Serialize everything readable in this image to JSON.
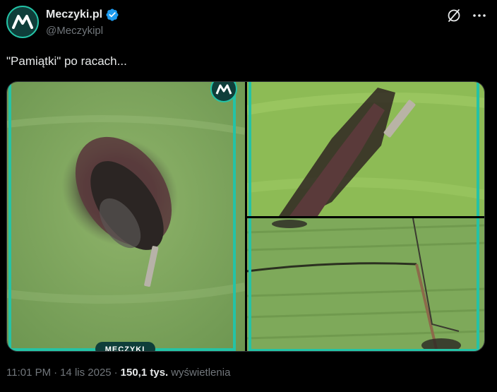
{
  "author": {
    "display_name": "Meczyki.pl",
    "handle": "@Meczykipl"
  },
  "icons": {
    "avatar": "meczyki-logo-icon",
    "verified": "verified-badge-icon",
    "grok": "grok-icon",
    "more": "more-dots-icon"
  },
  "tweet": {
    "text": "\"Pamiątki\" po racach..."
  },
  "media": {
    "watermark": "MECZYKI",
    "photos": [
      "burnt-turf-flare-closeup",
      "burnt-turf-flare-side",
      "turf-seam-damage"
    ]
  },
  "meta": {
    "time": "11:01 PM",
    "sep1": "·",
    "date": "14 lis 2025",
    "sep2": "·",
    "views_count": "150,1 tys.",
    "views_label": "wyświetlenia"
  },
  "colors": {
    "accent": "#24c3a6",
    "verified": "#1d9bf0",
    "text": "#e7e9ea",
    "muted": "#71767b"
  }
}
